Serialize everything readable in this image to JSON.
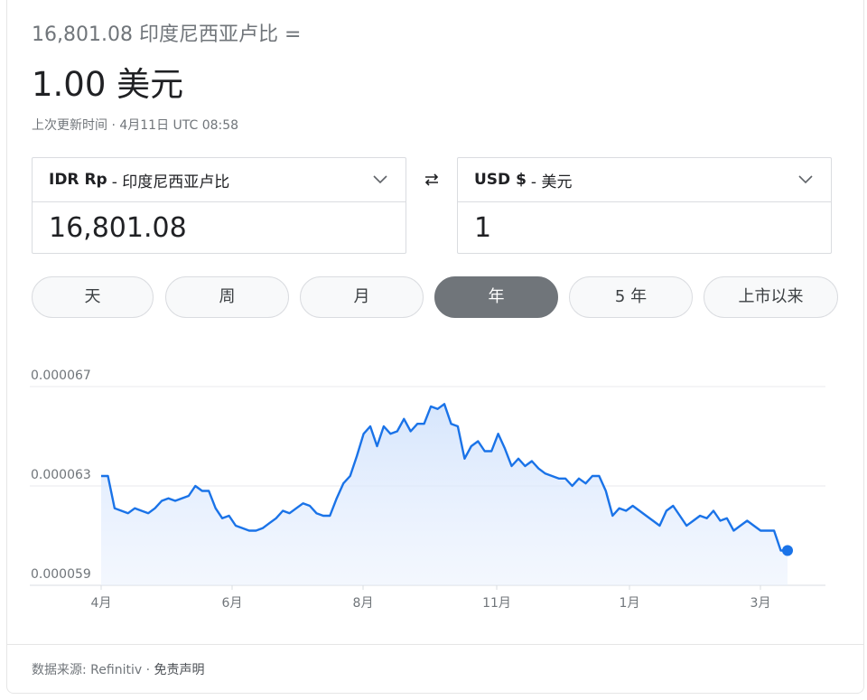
{
  "summary": {
    "from_amount": "16,801.08",
    "from_currency_name": "印度尼西亚卢比",
    "equals_sign": "=",
    "to_amount": "1.00",
    "to_currency_name": "美元",
    "updated": "上次更新时间 · 4月11日 UTC 08:58"
  },
  "converter": {
    "from": {
      "code": "IDR Rp",
      "name": "- 印度尼西亚卢比",
      "value": "16,801.08"
    },
    "to": {
      "code": "USD $",
      "name": "- 美元",
      "value": "1"
    },
    "swap_icon": "swap-arrows-icon"
  },
  "range_tabs": [
    {
      "label": "天",
      "active": false
    },
    {
      "label": "周",
      "active": false
    },
    {
      "label": "月",
      "active": false
    },
    {
      "label": "年",
      "active": true
    },
    {
      "label": "5 年",
      "active": false
    },
    {
      "label": "上市以来",
      "active": false
    }
  ],
  "chart_data": {
    "type": "area",
    "y_ticks": [
      "0.000067",
      "0.000063",
      "0.000059"
    ],
    "ylim": [
      5.9e-05,
      6.7e-05
    ],
    "x_ticks": [
      "4月",
      "6月",
      "8月",
      "11月",
      "1月",
      "3月"
    ],
    "grid": true,
    "colors": {
      "line": "#1a73e8",
      "fill": "#e8f0fe"
    },
    "series": [
      {
        "values": [
          6.34e-05,
          6.34e-05,
          6.21e-05,
          6.2e-05,
          6.19e-05,
          6.21e-05,
          6.2e-05,
          6.19e-05,
          6.21e-05,
          6.24e-05,
          6.25e-05,
          6.24e-05,
          6.25e-05,
          6.26e-05,
          6.3e-05,
          6.28e-05,
          6.28e-05,
          6.21e-05,
          6.17e-05,
          6.18e-05,
          6.14e-05,
          6.13e-05,
          6.12e-05,
          6.12e-05,
          6.13e-05,
          6.15e-05,
          6.17e-05,
          6.2e-05,
          6.19e-05,
          6.21e-05,
          6.23e-05,
          6.22e-05,
          6.19e-05,
          6.18e-05,
          6.18e-05,
          6.25e-05,
          6.31e-05,
          6.34e-05,
          6.42e-05,
          6.51e-05,
          6.54e-05,
          6.46e-05,
          6.54e-05,
          6.51e-05,
          6.52e-05,
          6.57e-05,
          6.52e-05,
          6.55e-05,
          6.55e-05,
          6.62e-05,
          6.61e-05,
          6.63e-05,
          6.55e-05,
          6.54e-05,
          6.41e-05,
          6.46e-05,
          6.48e-05,
          6.44e-05,
          6.44e-05,
          6.51e-05,
          6.45e-05,
          6.38e-05,
          6.41e-05,
          6.38e-05,
          6.4e-05,
          6.37e-05,
          6.35e-05,
          6.34e-05,
          6.33e-05,
          6.33e-05,
          6.3e-05,
          6.33e-05,
          6.31e-05,
          6.34e-05,
          6.34e-05,
          6.28e-05,
          6.18e-05,
          6.21e-05,
          6.2e-05,
          6.22e-05,
          6.2e-05,
          6.18e-05,
          6.16e-05,
          6.14e-05,
          6.2e-05,
          6.22e-05,
          6.18e-05,
          6.14e-05,
          6.16e-05,
          6.18e-05,
          6.17e-05,
          6.2e-05,
          6.16e-05,
          6.17e-05,
          6.12e-05,
          6.14e-05,
          6.16e-05,
          6.14e-05,
          6.12e-05,
          6.12e-05,
          6.12e-05,
          6.04e-05,
          6.04e-05
        ]
      }
    ]
  },
  "footer": {
    "source": "数据来源: Refinitiv · ",
    "disclaimer": "免责声明"
  }
}
